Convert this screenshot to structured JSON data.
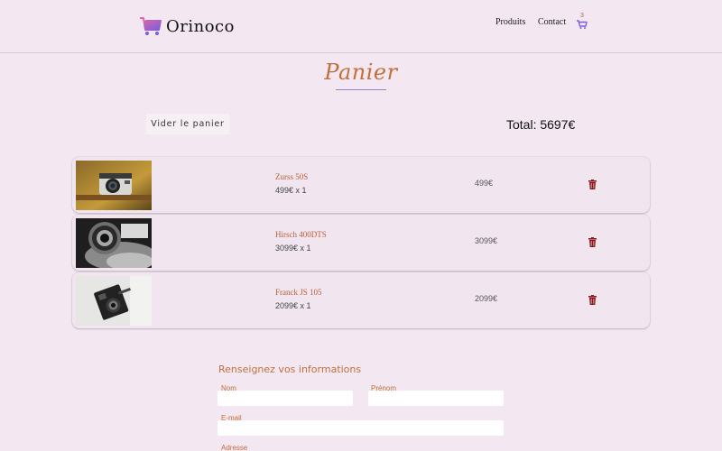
{
  "header": {
    "brand": "Orinoco",
    "nav_produits": "Produits",
    "nav_contact": "Contact",
    "cart_count": "3",
    "brand_gradient": [
      "#e76d9a",
      "#7c5ce0"
    ]
  },
  "page": {
    "title": "Panier",
    "empty_cart_label": "Vider le panier",
    "total_label": "Total: 5697€"
  },
  "cart_items": [
    {
      "name": "Zurss 50S",
      "qty_line": "499€ x 1",
      "price": "499€"
    },
    {
      "name": "Hirsch 400DTS",
      "qty_line": "3099€ x 1",
      "price": "3099€"
    },
    {
      "name": "Franck JS 105",
      "qty_line": "2099€ x 1",
      "price": "2099€"
    }
  ],
  "form": {
    "title": "Renseignez vos informations",
    "nom_label": "Nom",
    "prenom_label": "Prénom",
    "email_label": "E-mail",
    "adresse_label": "Adresse"
  },
  "colors": {
    "background": "#f3e7f1",
    "accent": "#c0703b",
    "trash": "#8b1a1a"
  }
}
